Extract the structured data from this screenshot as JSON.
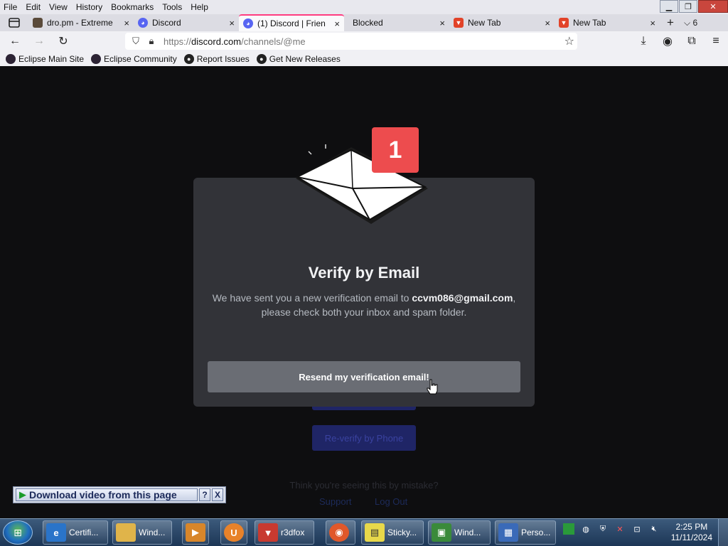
{
  "menu": [
    "File",
    "Edit",
    "View",
    "History",
    "Bookmarks",
    "Tools",
    "Help"
  ],
  "tabs": [
    {
      "label": "dro.pm - Extreme",
      "close": "×",
      "icon": "dro-favicon"
    },
    {
      "label": "Discord",
      "close": "×",
      "icon": "discord-icon"
    },
    {
      "label": "(1) Discord | Frien",
      "close": "×",
      "icon": "discord-icon",
      "active": true
    },
    {
      "label": "Blocked",
      "close": "×",
      "icon": ""
    },
    {
      "label": "New Tab",
      "close": "×",
      "icon": "gitlab-fox-icon"
    },
    {
      "label": "New Tab",
      "close": "×",
      "icon": "gitlab-fox-icon"
    }
  ],
  "tab_overflow": "6",
  "url": {
    "prefix": "https://",
    "host": "discord.com",
    "path": "/channels/@me"
  },
  "bookmarks": [
    {
      "label": "Eclipse Main Site",
      "icon": "eclipse-icon"
    },
    {
      "label": "Eclipse Community",
      "icon": "eclipse-icon"
    },
    {
      "label": "Report Issues",
      "icon": "github-icon"
    },
    {
      "label": "Get New Releases",
      "icon": "github-icon"
    }
  ],
  "modal": {
    "badge": "1",
    "title": "Verify by Email",
    "desc_before": "We have sent you a new verification email to ",
    "email": "ccvm086@gmail.com",
    "desc_after": ", please check both your inbox and spam folder.",
    "resend_button": "Resend my verification email!"
  },
  "background_page": {
    "reverify_phone": "Re-verify by Phone",
    "mistake_text": "Think you're seeing this by mistake?",
    "support_link": "Support",
    "logout_link": "Log Out"
  },
  "download_bar": {
    "label": "Download video from this page",
    "help": "?",
    "close": "X"
  },
  "taskbar": {
    "items": [
      {
        "label": "Certifi...",
        "icon": "ie-icon",
        "color": "#2a74c9"
      },
      {
        "label": "Wind...",
        "icon": "explorer-folder-icon",
        "color": "#e0b44a"
      },
      {
        "label": "",
        "icon": "media-player-icon",
        "color": "#d8862a"
      },
      {
        "label": "",
        "icon": "uc-browser-icon",
        "color": "#e8822a"
      },
      {
        "label": "r3dfox",
        "icon": "r3dfox-icon",
        "color": "#c83a30"
      },
      {
        "label": "",
        "icon": "firefox-icon",
        "color": "#e0582a"
      },
      {
        "label": "Sticky...",
        "icon": "sticky-notes-icon",
        "color": "#e8d84a"
      },
      {
        "label": "Wind...",
        "icon": "terminal-icon",
        "color": "#3a8a3a"
      },
      {
        "label": "Perso...",
        "icon": "personalize-icon",
        "color": "#3a6ab8"
      }
    ],
    "time": "2:25 PM",
    "date": "11/11/2024"
  }
}
